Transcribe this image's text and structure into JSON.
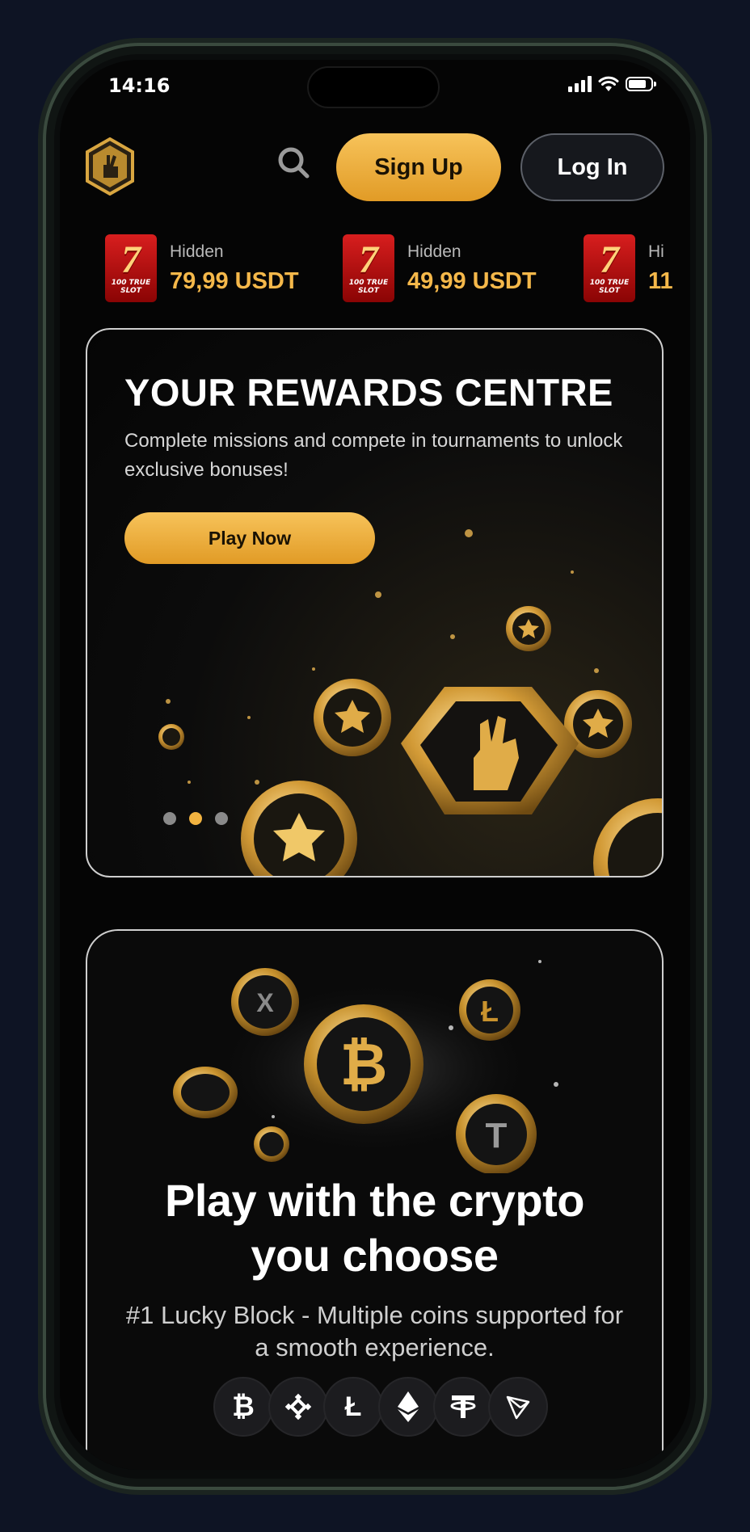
{
  "status_bar": {
    "time": "14:16"
  },
  "header": {
    "signup_label": "Sign Up",
    "login_label": "Log In"
  },
  "ticker": [
    {
      "name": "Hidden",
      "price": "79,99 USDT",
      "slot_label": "100 TRUE SLOT"
    },
    {
      "name": "Hidden",
      "price": "49,99 USDT",
      "slot_label": "100 TRUE SLOT"
    },
    {
      "name": "Hi",
      "price": "11",
      "slot_label": "100 TRUE SLOT"
    }
  ],
  "rewards": {
    "title": "YOUR REWARDS CENTRE",
    "description": "Complete missions and compete in tournaments to unlock exclusive bonuses!",
    "cta_label": "Play Now",
    "carousel_active_index": 1,
    "carousel_count": 3
  },
  "crypto": {
    "title_line1": "Play with the crypto",
    "title_line2": "you choose",
    "subtitle": "#1 Lucky Block - Multiple coins supported for a smooth experience.",
    "coins": [
      "bitcoin-icon",
      "binance-icon",
      "litecoin-icon",
      "ethereum-icon",
      "tether-icon",
      "tron-icon"
    ]
  },
  "colors": {
    "accent_gold": "#f2b340",
    "background": "#050505",
    "outer_bg": "#0e1424"
  }
}
